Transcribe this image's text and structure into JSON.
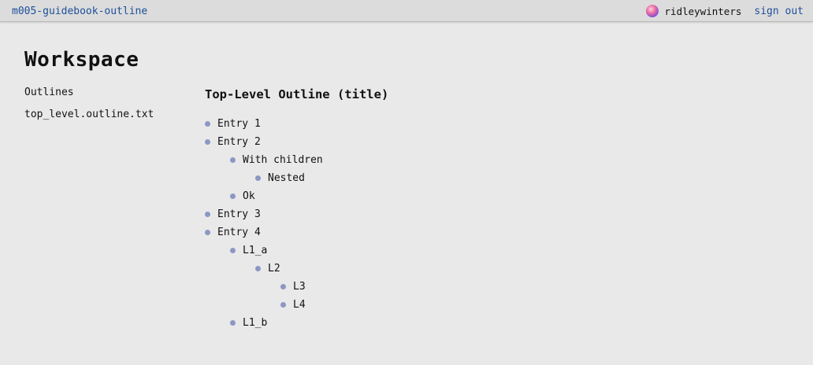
{
  "header": {
    "app_title": "m005-guidebook-outline",
    "username": "ridleywinters",
    "signout_label": "sign out"
  },
  "page": {
    "title": "Workspace"
  },
  "sidebar": {
    "heading": "Outlines",
    "items": [
      {
        "label": "top_level.outline.txt"
      }
    ]
  },
  "outline": {
    "title": "Top-Level Outline (title)",
    "entries": [
      {
        "label": "Entry 1"
      },
      {
        "label": "Entry 2",
        "children": [
          {
            "label": "With children",
            "children": [
              {
                "label": "Nested"
              }
            ]
          },
          {
            "label": "Ok"
          }
        ]
      },
      {
        "label": "Entry 3"
      },
      {
        "label": "Entry 4",
        "children": [
          {
            "label": "L1_a",
            "children": [
              {
                "label": "L2",
                "children": [
                  {
                    "label": "L3"
                  },
                  {
                    "label": "L4"
                  }
                ]
              }
            ]
          },
          {
            "label": "L1_b"
          }
        ]
      }
    ]
  },
  "colors": {
    "link": "#1d4f9a",
    "bullet": "#8c97c4",
    "background": "#e9e9e9",
    "topbar": "#dcdcdc"
  }
}
